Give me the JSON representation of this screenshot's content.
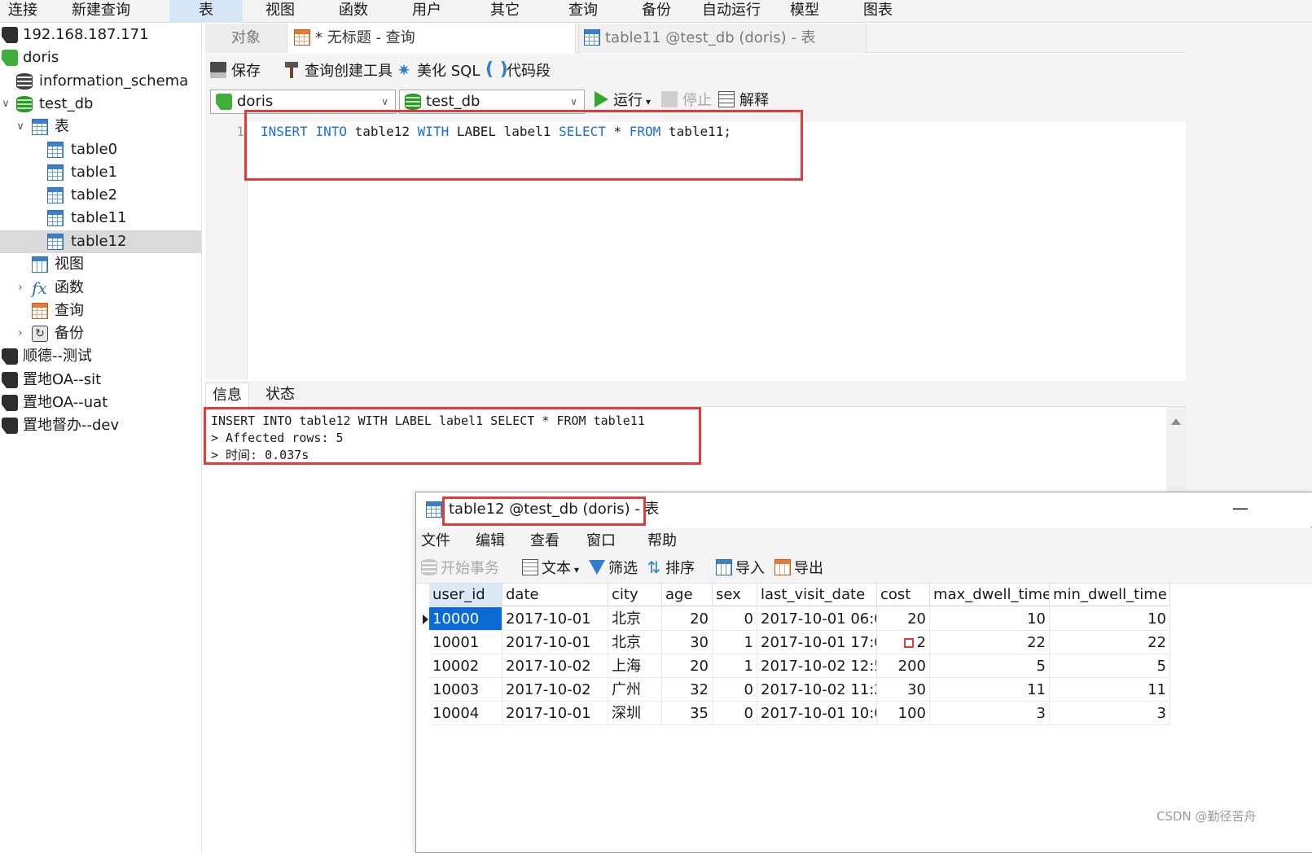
{
  "menu": [
    "连接",
    "新建查询",
    "表",
    "视图",
    "函数",
    "用户",
    "其它",
    "查询",
    "备份",
    "自动运行",
    "模型",
    "图表"
  ],
  "sidebar": {
    "connections_top": [
      "192.168.187.171",
      "doris"
    ],
    "databases": [
      "information_schema",
      "test_db"
    ],
    "table_group": "表",
    "tables": [
      "table0",
      "table1",
      "table2",
      "table11",
      "table12"
    ],
    "other_groups": [
      "视图",
      "函数",
      "查询",
      "备份"
    ],
    "connections_bottom": [
      "顺德--测试",
      "置地OA--sit",
      "置地OA--uat",
      "置地督办--dev"
    ]
  },
  "tabs": {
    "objects": "对象",
    "query": "* 无标题 - 查询",
    "table11": "table11 @test_db (doris) - 表"
  },
  "toolbar": {
    "save": "保存",
    "query_builder": "查询创建工具",
    "beautify": "美化 SQL",
    "snippet": "代码段",
    "connection": "doris",
    "database": "test_db",
    "run": "运行",
    "stop": "停止",
    "explain": "解释"
  },
  "editor": {
    "line_number": "1",
    "tokens": [
      {
        "t": "INSERT",
        "kw": true
      },
      {
        "t": " ",
        "kw": false
      },
      {
        "t": "INTO",
        "kw": true
      },
      {
        "t": " table12 ",
        "kw": false
      },
      {
        "t": "WITH",
        "kw": true
      },
      {
        "t": " LABEL label1 ",
        "kw": false
      },
      {
        "t": "SELECT",
        "kw": true
      },
      {
        "t": " * ",
        "kw": false
      },
      {
        "t": "FROM",
        "kw": true
      },
      {
        "t": " table11;",
        "kw": false
      }
    ]
  },
  "info_tabs": [
    "信息",
    "状态"
  ],
  "messages": [
    "INSERT INTO table12 WITH LABEL label1 SELECT * FROM table11",
    "> Affected rows: 5",
    "> 时间: 0.037s"
  ],
  "window": {
    "title": "table12 @test_db (doris) - 表",
    "minimize": "—",
    "menu": [
      "文件",
      "编辑",
      "查看",
      "窗口",
      "帮助"
    ],
    "tools": {
      "begin_tx": "开始事务",
      "text": "文本",
      "filter": "筛选",
      "sort": "排序",
      "import": "导入",
      "export": "导出"
    },
    "columns": [
      "user_id",
      "date",
      "city",
      "age",
      "sex",
      "last_visit_date",
      "cost",
      "max_dwell_time",
      "min_dwell_time"
    ],
    "rows": [
      [
        "10000",
        "2017-10-01",
        "北京",
        "20",
        "0",
        "2017-10-01 06:0(",
        "20",
        "10",
        "10"
      ],
      [
        "10001",
        "2017-10-01",
        "北京",
        "30",
        "1",
        "2017-10-01 17:0",
        "2",
        "22",
        "22"
      ],
      [
        "10002",
        "2017-10-02",
        "上海",
        "20",
        "1",
        "2017-10-02 12:5",
        "200",
        "5",
        "5"
      ],
      [
        "10003",
        "2017-10-02",
        "广州",
        "32",
        "0",
        "2017-10-02 11:2(",
        "30",
        "11",
        "11"
      ],
      [
        "10004",
        "2017-10-01",
        "深圳",
        "35",
        "0",
        "2017-10-01 10:0(",
        "100",
        "3",
        "3"
      ]
    ]
  },
  "watermark": "CSDN @勤径苦舟",
  "colors": {
    "accent": "#0a6ad6",
    "highlight": "#e23b3b",
    "keyword": "#1a6fd6",
    "run": "#36a530"
  }
}
